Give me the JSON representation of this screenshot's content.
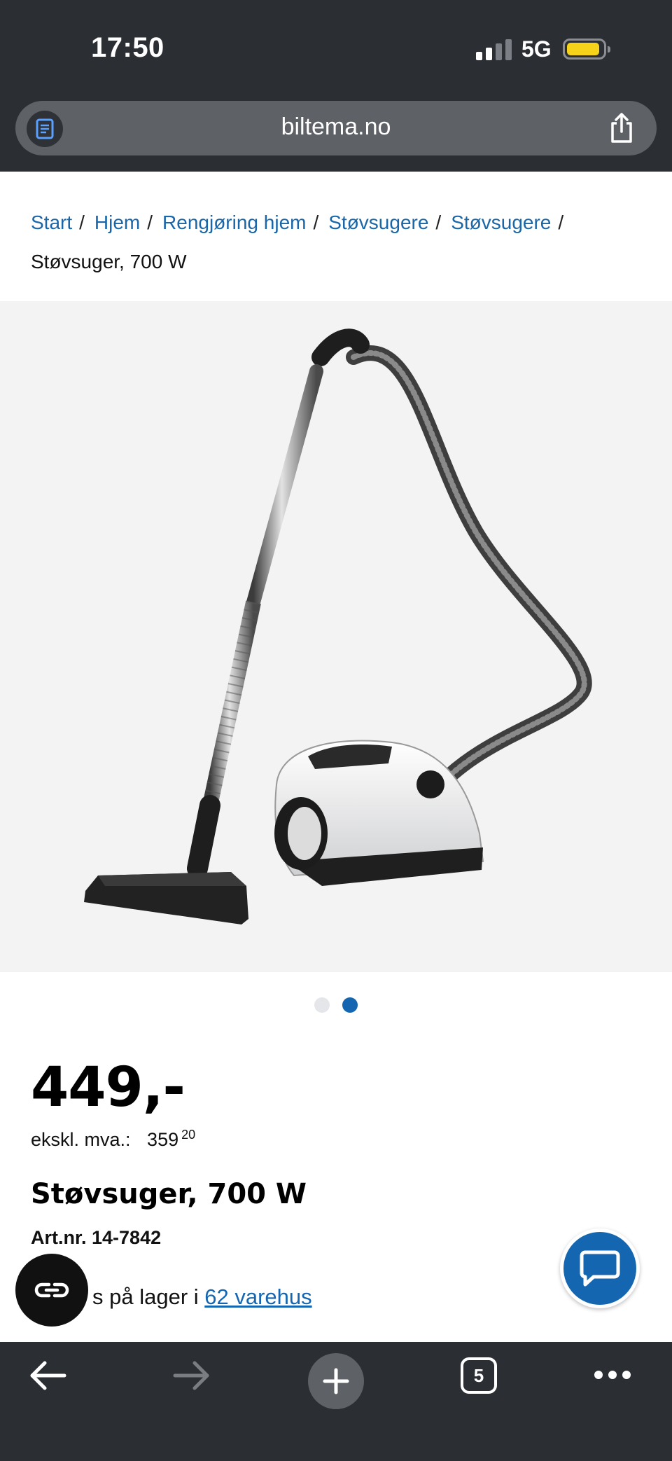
{
  "status": {
    "time": "17:50",
    "network": "5G"
  },
  "browser": {
    "url": "biltema.no"
  },
  "breadcrumb": {
    "items": [
      "Start",
      "Hjem",
      "Rengjøring hjem",
      "Støvsugere",
      "Støvsugere"
    ],
    "separator": "/",
    "current": "Støvsuger, 700 W"
  },
  "gallery": {
    "image_count": 2,
    "active_index": 1
  },
  "product": {
    "price": "449,-",
    "ex_vat_label": "ekskl. mva.:",
    "ex_vat_whole": "359",
    "ex_vat_decimals": "20",
    "title": "Støvsuger, 700 W",
    "article_number": "Art.nr. 14-7842",
    "stock_text_visible": "s på lager i",
    "stock_link": "62 varehus"
  },
  "toolbar": {
    "tab_count": "5"
  },
  "colors": {
    "link": "#1966a8",
    "accent": "#1566b0",
    "chrome": "#2b2e33"
  }
}
